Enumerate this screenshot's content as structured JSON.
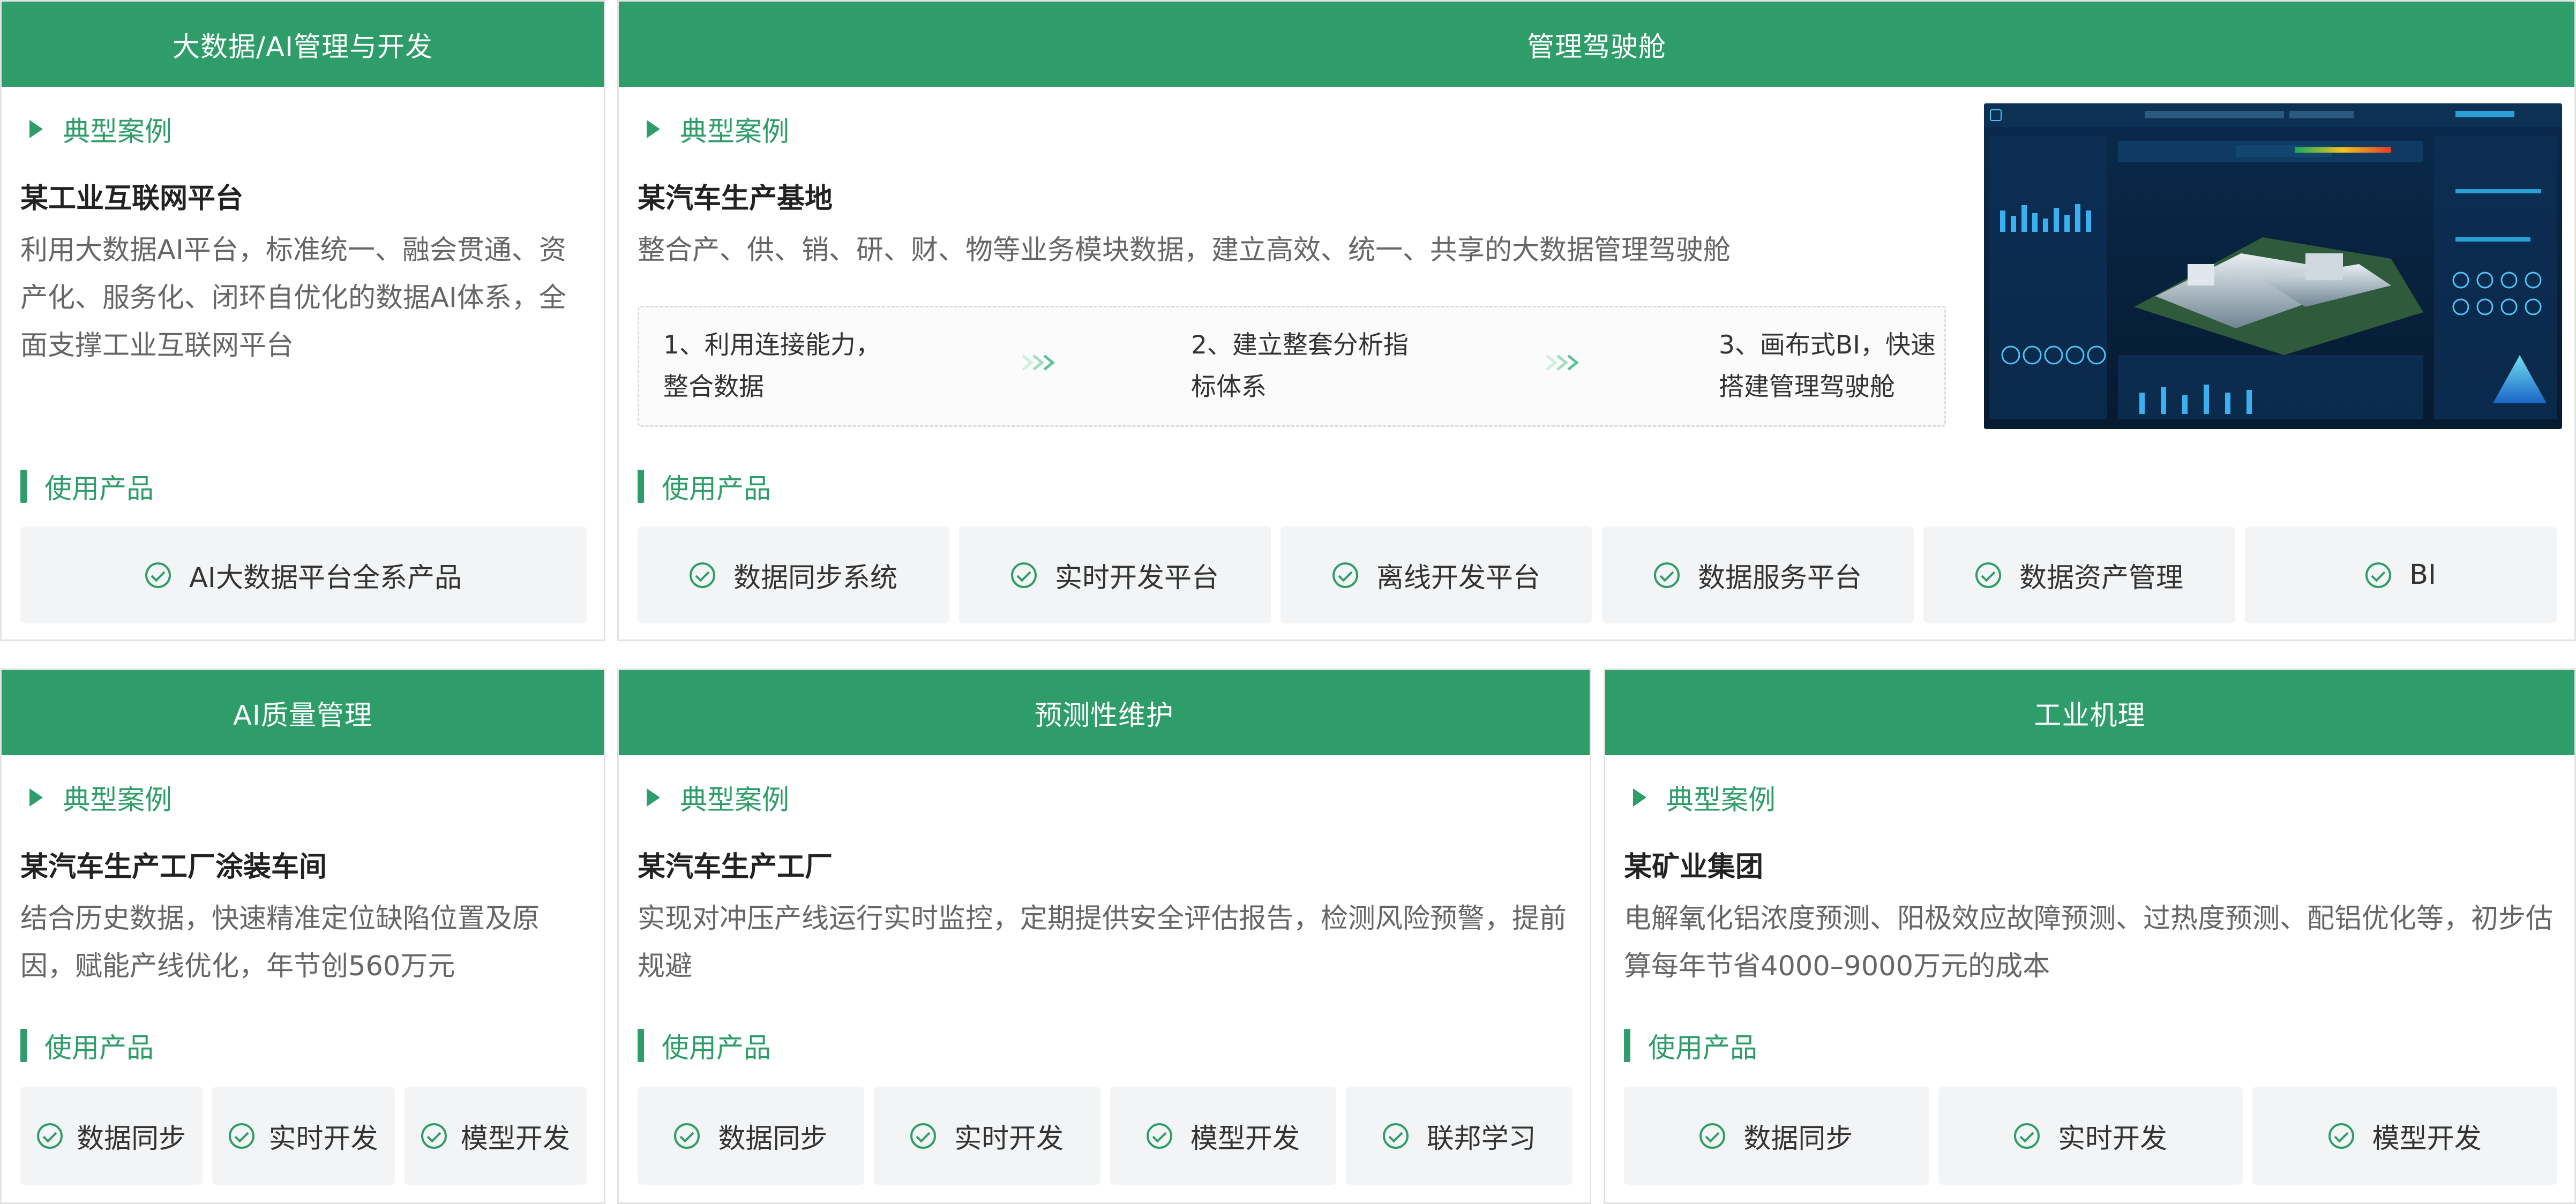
{
  "colors": {
    "accent": "#2f9d6a",
    "chip_bg": "#f3f4f5",
    "border": "#e2e2e2"
  },
  "common": {
    "case_label": "典型案例",
    "products_label": "使用产品",
    "icon": "check-circle-icon"
  },
  "cards": {
    "bigdata": {
      "header": "大数据/AI管理与开发",
      "case_title": "某工业互联网平台",
      "case_desc": "利用大数据AI平台，标准统一、融会贯通、资产化、服务化、闭环自优化的数据AI体系，全面支撑工业互联网平台",
      "products": [
        "AI大数据平台全系产品"
      ]
    },
    "cockpit": {
      "header": "管理驾驶舱",
      "case_title": "某汽车生产基地",
      "case_desc": "整合产、供、销、研、财、物等业务模块数据，建立高效、统一、共享的大数据管理驾驶舱",
      "steps": [
        "1、利用连接能力，\n整合数据",
        "2、建立整套分析指\n标体系",
        "3、画布式BI，快速\n搭建管理驾驶舱"
      ],
      "products": [
        "数据同步系统",
        "实时开发平台",
        "离线开发平台",
        "数据服务平台",
        "数据资产管理",
        "BI"
      ]
    },
    "quality": {
      "header": "AI质量管理",
      "case_title": "某汽车生产工厂涂装车间",
      "case_desc": "结合历史数据，快速精准定位缺陷位置及原因，赋能产线优化，年节创560万元",
      "products": [
        "数据同步",
        "实时开发",
        "模型开发"
      ]
    },
    "maintenance": {
      "header": "预测性维护",
      "case_title": "某汽车生产工厂",
      "case_desc": "实现对冲压产线运行实时监控，定期提供安全评估报告，检测风险预警，提前规避",
      "products": [
        "数据同步",
        "实时开发",
        "模型开发",
        "联邦学习"
      ]
    },
    "mechanism": {
      "header": "工业机理",
      "case_title": "某矿业集团",
      "case_desc": "电解氧化铝浓度预测、阳极效应故障预测、过热度预测、配铝优化等，初步估算每年节省4000–9000万元的成本",
      "products": [
        "数据同步",
        "实时开发",
        "模型开发"
      ]
    }
  }
}
